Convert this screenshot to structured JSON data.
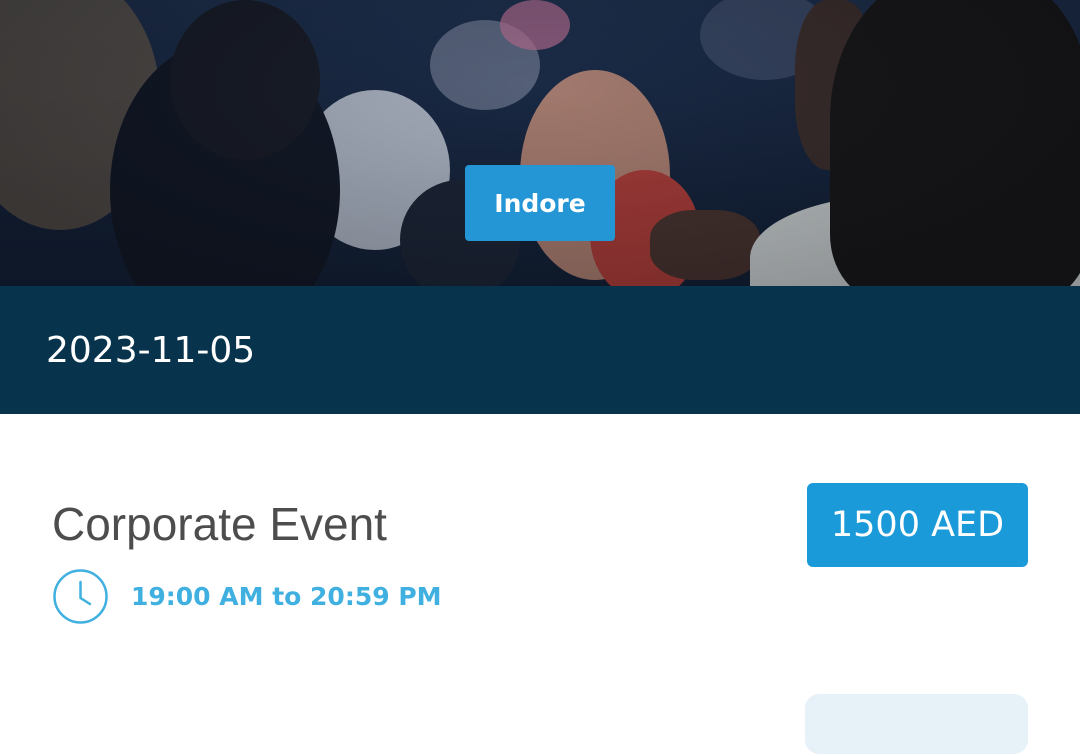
{
  "hero": {
    "city_label": "Indore",
    "date": "2023-11-05"
  },
  "event": {
    "title": "Corporate Event",
    "time_range": "19:00 AM to 20:59 PM",
    "price": "1500 AED"
  },
  "colors": {
    "accent": "#1a9ad9",
    "date_bar": "#07344c",
    "time_text": "#3fb0e0",
    "title_text": "#4d4d4d"
  },
  "icons": {
    "time": "clock-icon"
  }
}
